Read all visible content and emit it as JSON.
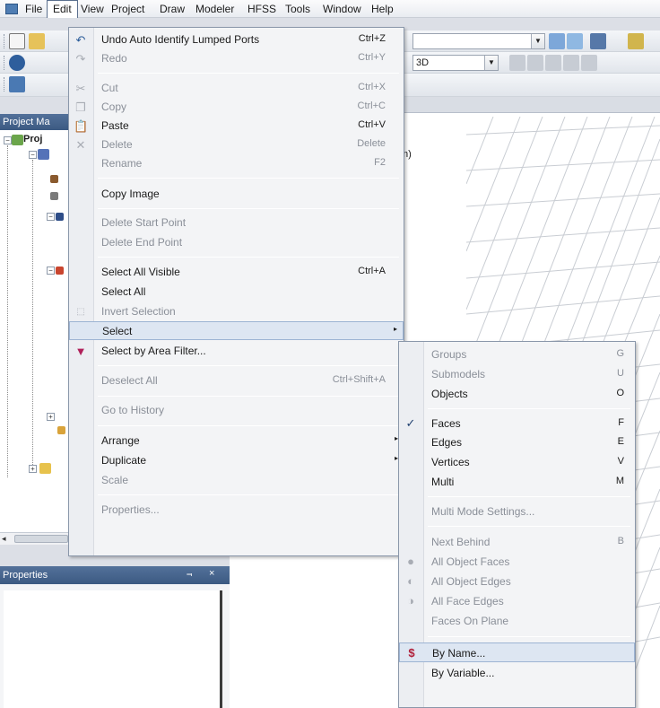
{
  "menubar": {
    "items": [
      "File",
      "Edit",
      "View",
      "Project",
      "Draw",
      "Modeler",
      "HFSS",
      "Tools",
      "Window",
      "Help"
    ]
  },
  "toolbar": {
    "view_mode": "3D"
  },
  "project_manager": {
    "title": "Project Ma",
    "root_label": "Proj"
  },
  "properties_panel": {
    "title": "Properties",
    "pin_glyph": "⫬",
    "close_glyph": "×"
  },
  "modeler": {
    "partial_text": "m)"
  },
  "edit_menu": {
    "items": [
      {
        "label": "Undo Auto Identify Lumped Ports",
        "shortcut": "Ctrl+Z",
        "enabled": true,
        "icon": "undo-icon"
      },
      {
        "label": "Redo",
        "shortcut": "Ctrl+Y",
        "enabled": false,
        "icon": "redo-icon"
      },
      {
        "label": "Cut",
        "shortcut": "Ctrl+X",
        "enabled": false,
        "icon": "cut-icon"
      },
      {
        "label": "Copy",
        "shortcut": "Ctrl+C",
        "enabled": false,
        "icon": "copy-icon"
      },
      {
        "label": "Paste",
        "shortcut": "Ctrl+V",
        "enabled": true,
        "icon": "paste-icon"
      },
      {
        "label": "Delete",
        "shortcut": "Delete",
        "enabled": false,
        "icon": "delete-icon"
      },
      {
        "label": "Rename",
        "shortcut": "F2",
        "enabled": false
      },
      {
        "label": "Copy Image",
        "shortcut": "",
        "enabled": true
      },
      {
        "label": "Delete Start Point",
        "shortcut": "",
        "enabled": false
      },
      {
        "label": "Delete End Point",
        "shortcut": "",
        "enabled": false
      },
      {
        "label": "Select All Visible",
        "shortcut": "Ctrl+A",
        "enabled": true
      },
      {
        "label": "Select All",
        "shortcut": "",
        "enabled": true
      },
      {
        "label": "Invert Selection",
        "shortcut": "",
        "enabled": false,
        "icon": "invert-selection-icon"
      },
      {
        "label": "Select",
        "shortcut": "",
        "enabled": true,
        "submenu": true
      },
      {
        "label": "Select by Area Filter...",
        "shortcut": "",
        "enabled": true,
        "icon": "filter-icon"
      },
      {
        "label": "Deselect All",
        "shortcut": "Ctrl+Shift+A",
        "enabled": false
      },
      {
        "label": "Go to History",
        "shortcut": "",
        "enabled": false
      },
      {
        "label": "Arrange",
        "shortcut": "",
        "enabled": true,
        "submenu": true
      },
      {
        "label": "Duplicate",
        "shortcut": "",
        "enabled": true,
        "submenu": true
      },
      {
        "label": "Scale",
        "shortcut": "",
        "enabled": false
      },
      {
        "label": "Properties...",
        "shortcut": "",
        "enabled": false
      }
    ],
    "submenu_arrow": "▸"
  },
  "select_submenu": {
    "items": [
      {
        "label": "Groups",
        "shortcut": "G",
        "enabled": false
      },
      {
        "label": "Submodels",
        "shortcut": "U",
        "enabled": false
      },
      {
        "label": "Objects",
        "shortcut": "O",
        "enabled": true
      },
      {
        "label": "Faces",
        "shortcut": "F",
        "enabled": true,
        "checked": true
      },
      {
        "label": "Edges",
        "shortcut": "E",
        "enabled": true
      },
      {
        "label": "Vertices",
        "shortcut": "V",
        "enabled": true
      },
      {
        "label": "Multi",
        "shortcut": "M",
        "enabled": true
      },
      {
        "label": "Multi Mode Settings...",
        "shortcut": "",
        "enabled": false
      },
      {
        "label": "Next Behind",
        "shortcut": "B",
        "enabled": false
      },
      {
        "label": "All Object Faces",
        "shortcut": "",
        "enabled": false,
        "icon": "all-object-faces-icon"
      },
      {
        "label": "All Object Edges",
        "shortcut": "",
        "enabled": false,
        "icon": "all-object-edges-icon"
      },
      {
        "label": "All Face Edges",
        "shortcut": "",
        "enabled": false,
        "icon": "all-face-edges-icon"
      },
      {
        "label": "Faces On Plane",
        "shortcut": "",
        "enabled": false
      },
      {
        "label": "By Name...",
        "shortcut": "",
        "enabled": true,
        "icon": "by-name-icon",
        "highlighted": true
      },
      {
        "label": "By Variable...",
        "shortcut": "",
        "enabled": true
      }
    ],
    "check_glyph": "✓"
  },
  "colors": {
    "menu_highlight": "#dde6f2",
    "disabled_text": "#8a8f98",
    "panel_title": "#3c5a82"
  }
}
